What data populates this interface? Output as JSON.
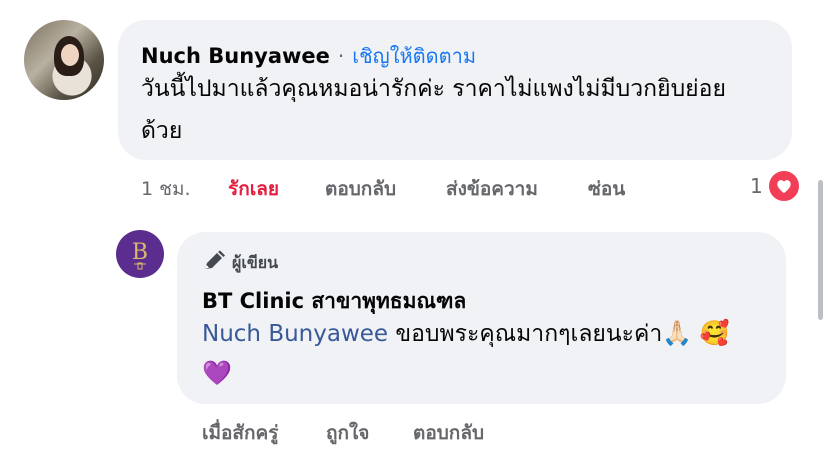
{
  "comment": {
    "author": "Nuch Bunyawee",
    "separator": "·",
    "follow_label": "เชิญให้ติดตาม",
    "text_line1": "วันนี้ไปมาแล้วคุณหมอน่ารักค่ะ ราคาไม่แพงไม่มีบวกยิบย่อย",
    "text_line2": "ด้วย",
    "actions": {
      "time": "1 ชม.",
      "like": "รักเลย",
      "reply": "ตอบกลับ",
      "message": "ส่งข้อความ",
      "hide": "ซ่อน"
    },
    "reaction_count": "1",
    "reaction_icon": "heart-icon"
  },
  "reply": {
    "badge_icon": "pencil-icon",
    "badge_label": "ผู้เขียน",
    "author": "BT Clinic สาขาพุทธมณฑล",
    "mention": "Nuch Bunyawee",
    "text": " ขอบพระคุณมากๆเลยนะค่า",
    "emoji_1": "🙏🏻",
    "emoji_2": "🥰",
    "emoji_3": "💜",
    "actions": {
      "time": "เมื่อสักครู่",
      "like": "ถูกใจ",
      "reply": "ตอบกลับ"
    }
  },
  "colors": {
    "bubble": "#f0f2f5",
    "link": "#1877f2",
    "liked": "#e41e3f",
    "muted": "#65676b",
    "heart": "#f33e58",
    "avatar_brand": "#5b2d8e"
  }
}
